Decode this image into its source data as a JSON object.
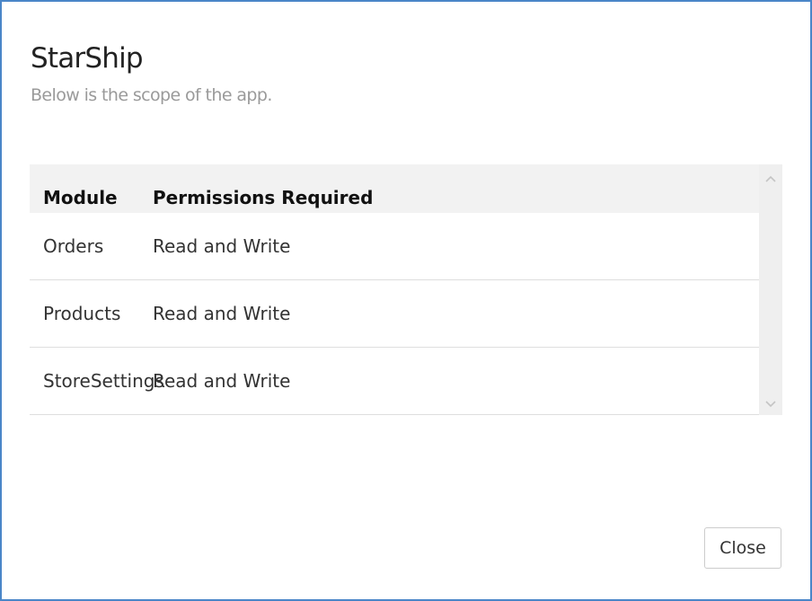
{
  "dialog": {
    "title": "StarShip",
    "subtitle": "Below is the scope of the app."
  },
  "table": {
    "headers": [
      "Module",
      "Permissions Required"
    ],
    "rows": [
      [
        "Orders",
        "Read and Write"
      ],
      [
        "Products",
        "Read and Write"
      ],
      [
        "StoreSettings",
        "Read and Write"
      ]
    ]
  },
  "scrollbar": {
    "up_icon": "chevron-up-icon",
    "down_icon": "chevron-down-icon"
  },
  "footer": {
    "close_label": "Close"
  },
  "colors": {
    "border": "#4a86c8",
    "header_bg": "#f2f2f2",
    "subtitle": "#9a9a9a"
  }
}
